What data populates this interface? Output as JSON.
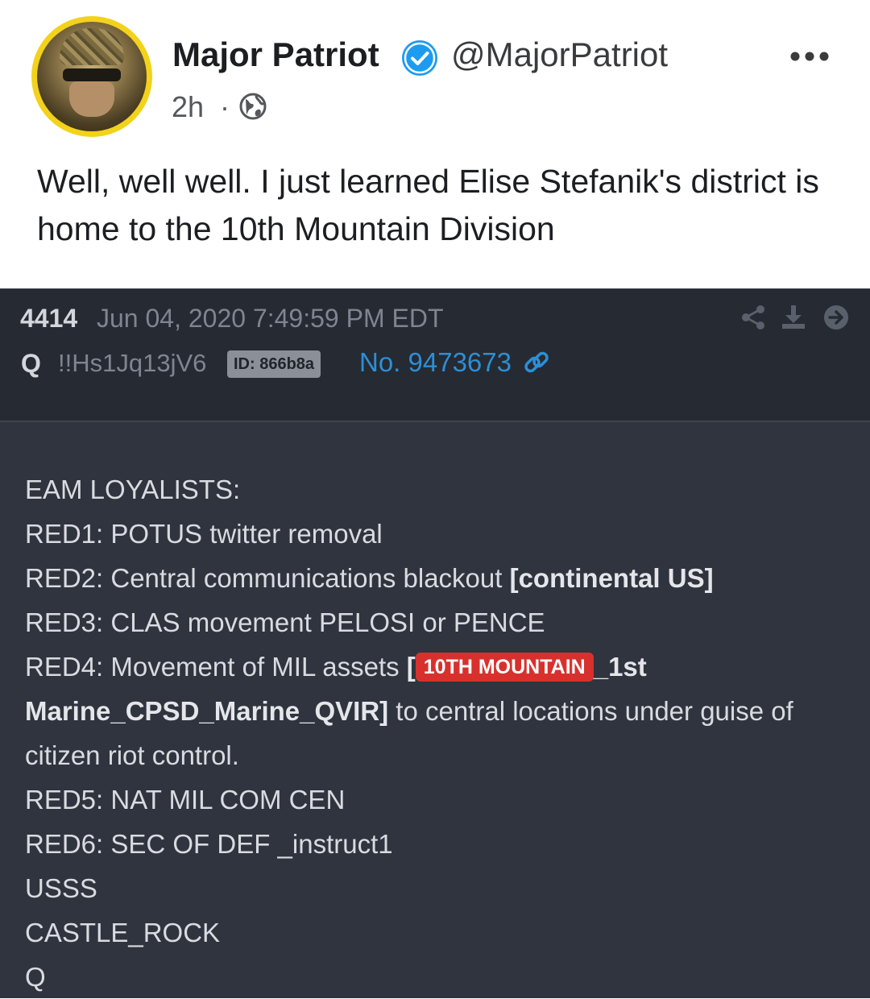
{
  "tweet": {
    "author_name": "Major Patriot",
    "handle": "@MajorPatriot",
    "time": "2h",
    "separator": "·",
    "text": "Well, well well. I just learned Elise Stefanik's district is home to the 10th Mountain Division",
    "colors": {
      "avatar_ring": "#f2d21b",
      "verified": "#1d9bf0"
    },
    "icons": [
      "verified-badge-icon",
      "globe-icon",
      "more-options-icon"
    ]
  },
  "qpost": {
    "post_number": "4414",
    "date": "Jun 04, 2020 7:49:59 PM EDT",
    "author": "Q",
    "tripcode": "!!Hs1Jq13jV6",
    "id_badge": "ID: 866b8a",
    "post_no": "No. 9473673",
    "icons": [
      "share-icon",
      "download-icon",
      "goto-icon",
      "link-icon"
    ],
    "lines": {
      "l1": "EAM LOYALISTS:",
      "l2": "RED1: POTUS twitter removal",
      "l3a": "RED2: Central communications blackout ",
      "l3b": "[continental US]",
      "l4": "RED3: CLAS movement PELOSI or PENCE",
      "l5a": "RED4: Movement of MIL assets ",
      "l5b": "[",
      "l5tag": "10TH MOUNTAIN",
      "l5c": "_1st",
      "l6a": "Marine_CPSD_Marine_QVIR]",
      "l6b": " to central locations under guise of",
      "l7": "citizen riot control.",
      "l8": "RED5: NAT MIL COM CEN",
      "l9": "RED6: SEC OF DEF _instruct1",
      "l10": "USSS",
      "l11": "CASTLE_ROCK",
      "l12": "Q"
    },
    "colors": {
      "background": "#2f343e",
      "header": "#262a32",
      "highlight": "#d8312d",
      "link": "#2c8fd6"
    }
  }
}
